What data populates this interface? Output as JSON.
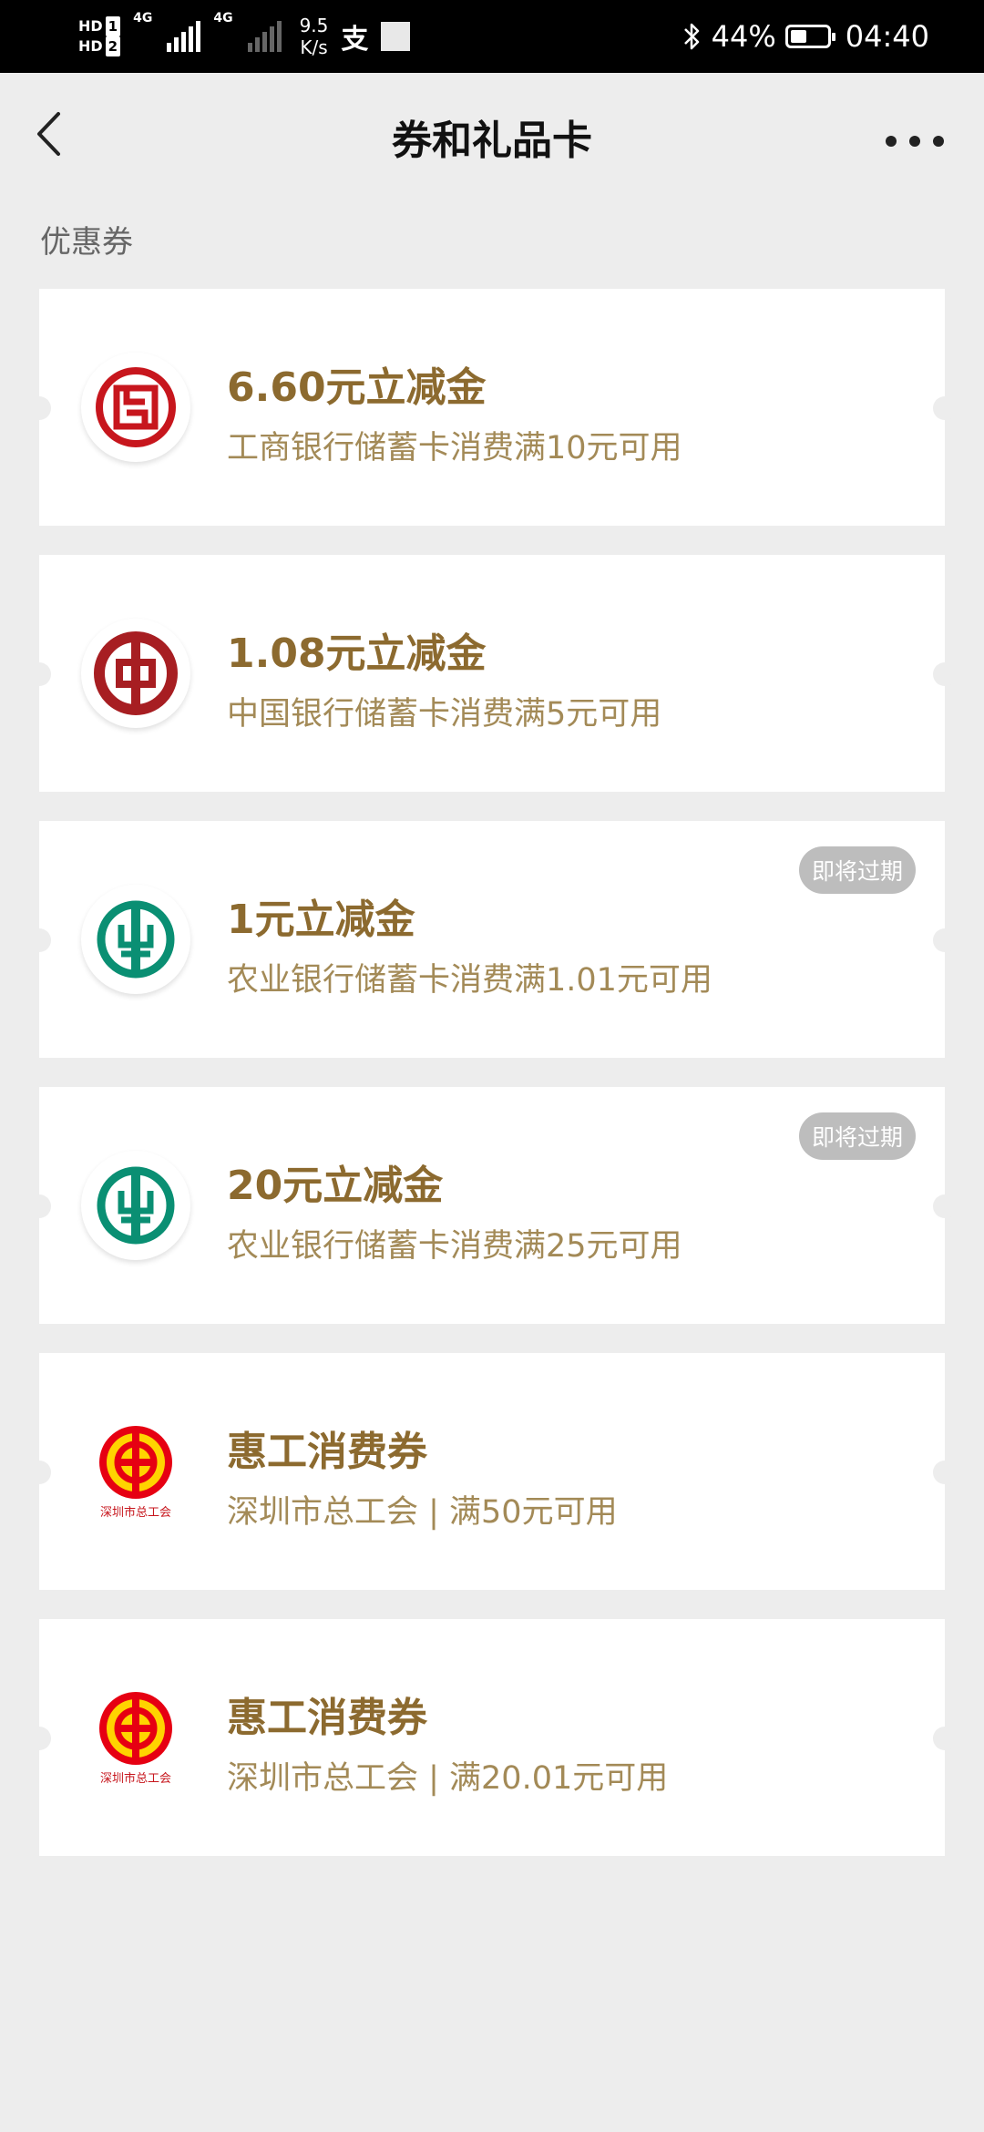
{
  "status_bar": {
    "hd1": "HD",
    "hd1_num": "1",
    "hd2": "HD",
    "hd2_num": "2",
    "net1": "4G",
    "net2": "4G",
    "speed_value": "9.5",
    "speed_unit": "K/s",
    "pay_glyph": "支",
    "battery": "44%",
    "battery_level": 44,
    "time": "04:40"
  },
  "header": {
    "title": "券和礼品卡"
  },
  "section": {
    "title": "优惠券"
  },
  "colors": {
    "icbc": "#c7161d",
    "boc": "#a71e22",
    "abc": "#0a8f73",
    "union": "#e60012",
    "title": "#8c6a2f",
    "desc": "#a38a57"
  },
  "coupons": [
    {
      "title": "6.60元立减金",
      "desc": "工商银行储蓄卡消费满10元可用",
      "badge": "",
      "logo": "icbc-logo-icon"
    },
    {
      "title": "1.08元立减金",
      "desc": "中国银行储蓄卡消费满5元可用",
      "badge": "",
      "logo": "boc-logo-icon"
    },
    {
      "title": "1元立减金",
      "desc": "农业银行储蓄卡消费满1.01元可用",
      "badge": "即将过期",
      "logo": "abc-logo-icon"
    },
    {
      "title": "20元立减金",
      "desc": "农业银行储蓄卡消费满25元可用",
      "badge": "即将过期",
      "logo": "abc-logo-icon"
    },
    {
      "title": "惠工消费券",
      "desc": "深圳市总工会 | 满50元可用",
      "badge": "",
      "logo": "union-logo-icon",
      "logo_caption": "深圳市总工会"
    },
    {
      "title": "惠工消费券",
      "desc": "深圳市总工会 | 满20.01元可用",
      "badge": "",
      "logo": "union-logo-icon",
      "logo_caption": "深圳市总工会"
    }
  ]
}
